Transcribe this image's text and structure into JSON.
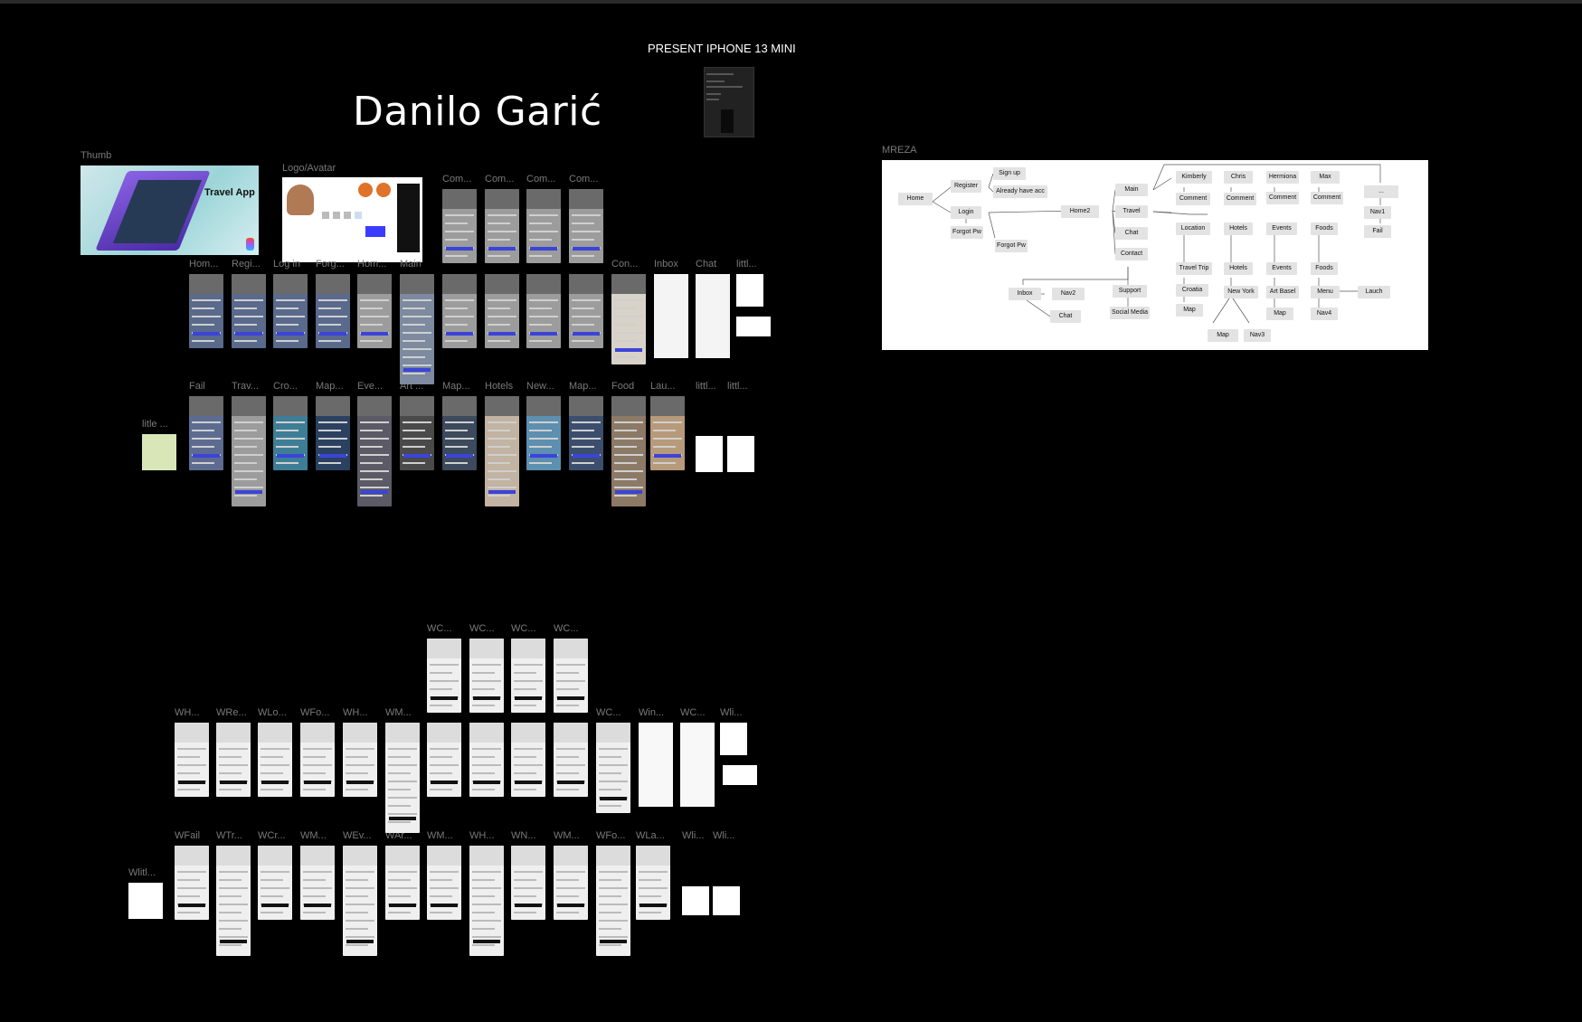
{
  "canvas": {
    "title": "Danilo Garić",
    "present_label": "PRESENT IPHONE 13 MINI"
  },
  "labels": {
    "thumb": "Thumb",
    "logo": "Logo/Avatar",
    "mreza": "MREZA",
    "thumb_text": "Travel App",
    "row1": [
      "Com...",
      "Com...",
      "Com...",
      "Com..."
    ],
    "row2": [
      "Hom...",
      "Regi...",
      "Log in",
      "Forg...",
      "Hom...",
      "Main",
      "Con...",
      "Inbox",
      "Chat",
      "littl..."
    ],
    "row3": [
      "Fail",
      "Trav...",
      "Cro...",
      "Map...",
      "Eve...",
      "Art ...",
      "Map...",
      "Hotels",
      "New...",
      "Map...",
      "Food",
      "Lau...",
      "littl...",
      "littl..."
    ],
    "little_left": "litle ...",
    "w_row1": [
      "WC...",
      "WC...",
      "WC...",
      "WC..."
    ],
    "w_row2": [
      "WH...",
      "WRe...",
      "WLo...",
      "WFo...",
      "WH...",
      "WM...",
      "WC...",
      "Win...",
      "WC...",
      "Wli..."
    ],
    "w_row3": [
      "WFail",
      "WTr...",
      "WCr...",
      "WM...",
      "WEv...",
      "WAr...",
      "WM...",
      "WH...",
      "WN...",
      "WM...",
      "WFo...",
      "WLa...",
      "Wli...",
      "Wli..."
    ],
    "w_little_left": "Wlitl..."
  },
  "network": {
    "nodes": {
      "home": "Home",
      "register": "Register",
      "login": "Login",
      "signup": "Sign up",
      "already": "Already have acc",
      "forgot_pw": "Forgot Pw",
      "forgot_pw2": "Forgot Pw",
      "home2": "Home2",
      "main": "Main",
      "travel": "Travel",
      "chat": "Chat",
      "contact": "Contact",
      "kimberly": "Kimberly",
      "chris": "Chris",
      "hermiona": "Hermiona",
      "max": "Max",
      "comment1": "Comment",
      "comment2": "Comment",
      "comment3": "Comment",
      "comment4": "Comment",
      "dots": "...",
      "nav1": "Nav1",
      "fail": "Fail",
      "location": "Location",
      "hotels": "Hotels",
      "events": "Events",
      "foods": "Foods",
      "travel_trip": "Travel Trip",
      "hotels2": "Hotels",
      "events2": "Events",
      "foods2": "Foods",
      "croatia": "Croatia",
      "new_york": "New York",
      "art_basel": "Art Basel",
      "menu": "Menu",
      "lauch": "Lauch",
      "map1": "Map",
      "map2": "Map",
      "nav4": "Nav4",
      "map3": "Map",
      "nav3": "Nav3",
      "inbox": "Inbox",
      "nav2": "Nav2",
      "chat2": "Chat",
      "support": "Support",
      "social_media": "Social Media"
    }
  }
}
